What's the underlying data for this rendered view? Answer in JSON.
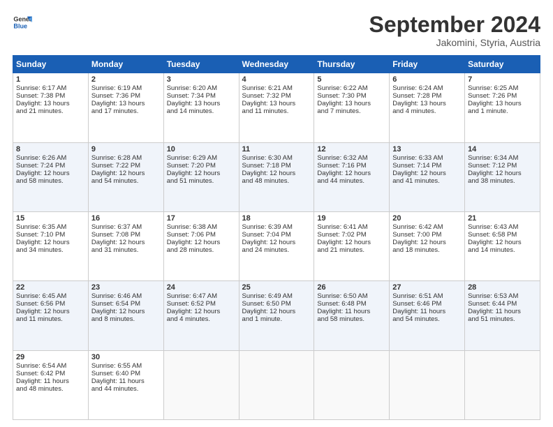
{
  "logo": {
    "line1": "General",
    "line2": "Blue"
  },
  "header": {
    "month": "September 2024",
    "location": "Jakomini, Styria, Austria"
  },
  "weekdays": [
    "Sunday",
    "Monday",
    "Tuesday",
    "Wednesday",
    "Thursday",
    "Friday",
    "Saturday"
  ],
  "weeks": [
    [
      {
        "day": "1",
        "lines": [
          "Sunrise: 6:17 AM",
          "Sunset: 7:38 PM",
          "Daylight: 13 hours",
          "and 21 minutes."
        ]
      },
      {
        "day": "2",
        "lines": [
          "Sunrise: 6:19 AM",
          "Sunset: 7:36 PM",
          "Daylight: 13 hours",
          "and 17 minutes."
        ]
      },
      {
        "day": "3",
        "lines": [
          "Sunrise: 6:20 AM",
          "Sunset: 7:34 PM",
          "Daylight: 13 hours",
          "and 14 minutes."
        ]
      },
      {
        "day": "4",
        "lines": [
          "Sunrise: 6:21 AM",
          "Sunset: 7:32 PM",
          "Daylight: 13 hours",
          "and 11 minutes."
        ]
      },
      {
        "day": "5",
        "lines": [
          "Sunrise: 6:22 AM",
          "Sunset: 7:30 PM",
          "Daylight: 13 hours",
          "and 7 minutes."
        ]
      },
      {
        "day": "6",
        "lines": [
          "Sunrise: 6:24 AM",
          "Sunset: 7:28 PM",
          "Daylight: 13 hours",
          "and 4 minutes."
        ]
      },
      {
        "day": "7",
        "lines": [
          "Sunrise: 6:25 AM",
          "Sunset: 7:26 PM",
          "Daylight: 13 hours",
          "and 1 minute."
        ]
      }
    ],
    [
      {
        "day": "8",
        "lines": [
          "Sunrise: 6:26 AM",
          "Sunset: 7:24 PM",
          "Daylight: 12 hours",
          "and 58 minutes."
        ]
      },
      {
        "day": "9",
        "lines": [
          "Sunrise: 6:28 AM",
          "Sunset: 7:22 PM",
          "Daylight: 12 hours",
          "and 54 minutes."
        ]
      },
      {
        "day": "10",
        "lines": [
          "Sunrise: 6:29 AM",
          "Sunset: 7:20 PM",
          "Daylight: 12 hours",
          "and 51 minutes."
        ]
      },
      {
        "day": "11",
        "lines": [
          "Sunrise: 6:30 AM",
          "Sunset: 7:18 PM",
          "Daylight: 12 hours",
          "and 48 minutes."
        ]
      },
      {
        "day": "12",
        "lines": [
          "Sunrise: 6:32 AM",
          "Sunset: 7:16 PM",
          "Daylight: 12 hours",
          "and 44 minutes."
        ]
      },
      {
        "day": "13",
        "lines": [
          "Sunrise: 6:33 AM",
          "Sunset: 7:14 PM",
          "Daylight: 12 hours",
          "and 41 minutes."
        ]
      },
      {
        "day": "14",
        "lines": [
          "Sunrise: 6:34 AM",
          "Sunset: 7:12 PM",
          "Daylight: 12 hours",
          "and 38 minutes."
        ]
      }
    ],
    [
      {
        "day": "15",
        "lines": [
          "Sunrise: 6:35 AM",
          "Sunset: 7:10 PM",
          "Daylight: 12 hours",
          "and 34 minutes."
        ]
      },
      {
        "day": "16",
        "lines": [
          "Sunrise: 6:37 AM",
          "Sunset: 7:08 PM",
          "Daylight: 12 hours",
          "and 31 minutes."
        ]
      },
      {
        "day": "17",
        "lines": [
          "Sunrise: 6:38 AM",
          "Sunset: 7:06 PM",
          "Daylight: 12 hours",
          "and 28 minutes."
        ]
      },
      {
        "day": "18",
        "lines": [
          "Sunrise: 6:39 AM",
          "Sunset: 7:04 PM",
          "Daylight: 12 hours",
          "and 24 minutes."
        ]
      },
      {
        "day": "19",
        "lines": [
          "Sunrise: 6:41 AM",
          "Sunset: 7:02 PM",
          "Daylight: 12 hours",
          "and 21 minutes."
        ]
      },
      {
        "day": "20",
        "lines": [
          "Sunrise: 6:42 AM",
          "Sunset: 7:00 PM",
          "Daylight: 12 hours",
          "and 18 minutes."
        ]
      },
      {
        "day": "21",
        "lines": [
          "Sunrise: 6:43 AM",
          "Sunset: 6:58 PM",
          "Daylight: 12 hours",
          "and 14 minutes."
        ]
      }
    ],
    [
      {
        "day": "22",
        "lines": [
          "Sunrise: 6:45 AM",
          "Sunset: 6:56 PM",
          "Daylight: 12 hours",
          "and 11 minutes."
        ]
      },
      {
        "day": "23",
        "lines": [
          "Sunrise: 6:46 AM",
          "Sunset: 6:54 PM",
          "Daylight: 12 hours",
          "and 8 minutes."
        ]
      },
      {
        "day": "24",
        "lines": [
          "Sunrise: 6:47 AM",
          "Sunset: 6:52 PM",
          "Daylight: 12 hours",
          "and 4 minutes."
        ]
      },
      {
        "day": "25",
        "lines": [
          "Sunrise: 6:49 AM",
          "Sunset: 6:50 PM",
          "Daylight: 12 hours",
          "and 1 minute."
        ]
      },
      {
        "day": "26",
        "lines": [
          "Sunrise: 6:50 AM",
          "Sunset: 6:48 PM",
          "Daylight: 11 hours",
          "and 58 minutes."
        ]
      },
      {
        "day": "27",
        "lines": [
          "Sunrise: 6:51 AM",
          "Sunset: 6:46 PM",
          "Daylight: 11 hours",
          "and 54 minutes."
        ]
      },
      {
        "day": "28",
        "lines": [
          "Sunrise: 6:53 AM",
          "Sunset: 6:44 PM",
          "Daylight: 11 hours",
          "and 51 minutes."
        ]
      }
    ],
    [
      {
        "day": "29",
        "lines": [
          "Sunrise: 6:54 AM",
          "Sunset: 6:42 PM",
          "Daylight: 11 hours",
          "and 48 minutes."
        ]
      },
      {
        "day": "30",
        "lines": [
          "Sunrise: 6:55 AM",
          "Sunset: 6:40 PM",
          "Daylight: 11 hours",
          "and 44 minutes."
        ]
      },
      {
        "day": "",
        "lines": []
      },
      {
        "day": "",
        "lines": []
      },
      {
        "day": "",
        "lines": []
      },
      {
        "day": "",
        "lines": []
      },
      {
        "day": "",
        "lines": []
      }
    ]
  ]
}
